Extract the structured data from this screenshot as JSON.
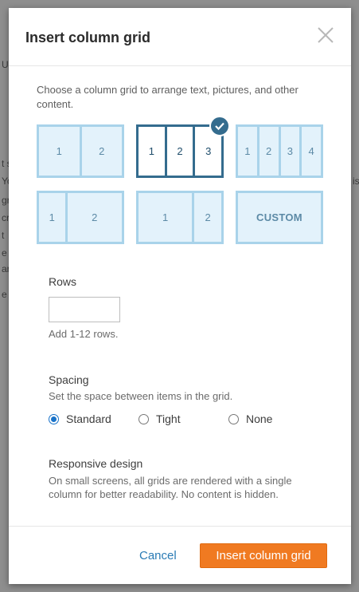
{
  "background": {
    "fragments": [
      "Up",
      "t s",
      "Yo",
      "gr",
      "cr",
      "t",
      "e",
      "ar",
      "e",
      "is"
    ]
  },
  "dialog": {
    "title": "Insert column grid",
    "intro": "Choose a column grid to arrange text, pictures, and other content.",
    "grids": [
      {
        "cols": [
          "1",
          "2"
        ],
        "selected": false
      },
      {
        "cols": [
          "1",
          "2",
          "3"
        ],
        "selected": true
      },
      {
        "cols": [
          "1",
          "2",
          "3",
          "4"
        ],
        "selected": false
      },
      {
        "cols": [
          "1",
          "2"
        ],
        "selected": false
      },
      {
        "cols": [
          "1",
          "2"
        ],
        "selected": false
      },
      {
        "label": "CUSTOM",
        "selected": false
      }
    ],
    "rows": {
      "label": "Rows",
      "value": "",
      "placeholder": "",
      "hint": "Add 1-12 rows."
    },
    "spacing": {
      "label": "Spacing",
      "hint": "Set the space between items in the grid.",
      "options": [
        {
          "label": "Standard",
          "checked": true
        },
        {
          "label": "Tight",
          "checked": false
        },
        {
          "label": "None",
          "checked": false
        }
      ]
    },
    "responsive": {
      "label": "Responsive design",
      "hint": "On small screens, all grids are rendered with a single column for better readability. No content is hidden."
    },
    "footer": {
      "cancel_label": "Cancel",
      "insert_label": "Insert column grid"
    }
  },
  "colors": {
    "accent": "#f07a21",
    "selected_border": "#346c8e",
    "grid_border": "#a9d3ea",
    "grid_fill": "#e3f2fb",
    "link": "#2a7bb5",
    "radio": "#1a73c9"
  }
}
